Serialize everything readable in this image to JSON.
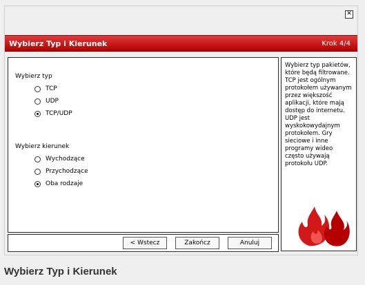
{
  "header": {
    "title": "Wybierz Typ i Kierunek",
    "step": "Krok 4/4"
  },
  "type_section": {
    "label": "Wybierz typ",
    "options": [
      {
        "label": "TCP",
        "selected": false
      },
      {
        "label": "UDP",
        "selected": false
      },
      {
        "label": "TCP/UDP",
        "selected": true
      }
    ]
  },
  "direction_section": {
    "label": "Wybierz kierunek",
    "options": [
      {
        "label": "Wychodzące",
        "selected": false
      },
      {
        "label": "Przychodzące",
        "selected": false
      },
      {
        "label": "Oba rodzaje",
        "selected": true
      }
    ]
  },
  "buttons": {
    "back": "< Wstecz",
    "finish": "Zakończ",
    "cancel": "Anuluj"
  },
  "help_text": "Wybierz typ pakietów, które będą filtrowane. TCP jest ogólnym protokołem używanym przez większość aplikacji, które mają dostęp do internetu. UDP jest wyskokowydajnym protokołem. Gry sieciowe i inne programy wideo często używają protokołu UDP.",
  "footer_title": "Wybierz Typ i Kierunek",
  "colors": {
    "header": "#c41010",
    "flame": "#cc0000"
  },
  "icons": {
    "close": "close-icon",
    "flames": "flames-logo"
  }
}
